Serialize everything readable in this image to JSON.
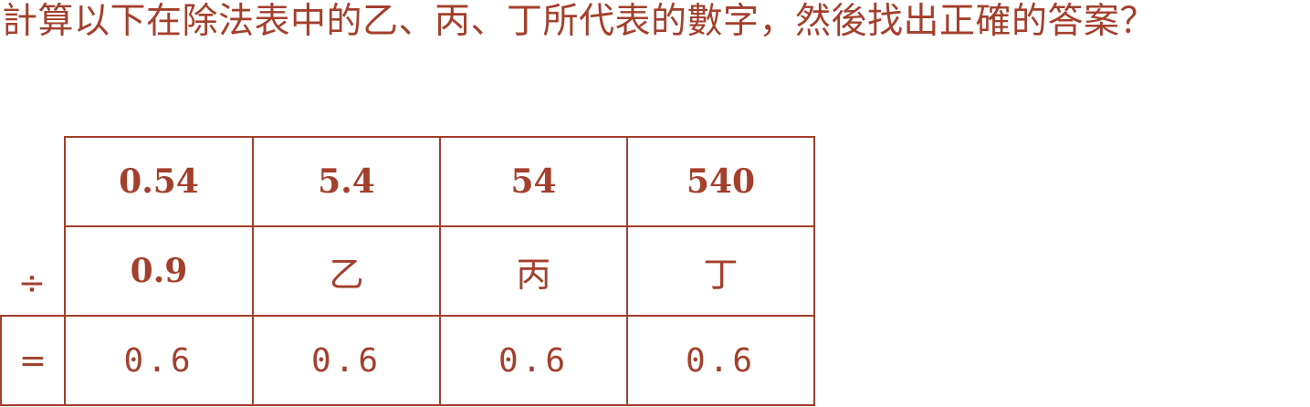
{
  "question": "計算以下在除法表中的乙、丙、丁所代表的數字，然後找出正確的答案？",
  "table": {
    "dividends": [
      "0.54",
      "5.4",
      "54",
      "540"
    ],
    "divide_sign": "÷",
    "divisors": [
      "0.9",
      "乙",
      "丙",
      "丁"
    ],
    "equals_sign": "=",
    "quotients": [
      "0.6",
      "0.6",
      "0.6",
      "0.6"
    ]
  },
  "colors": {
    "ink": "#a33f2c",
    "background": "#ffffff"
  }
}
